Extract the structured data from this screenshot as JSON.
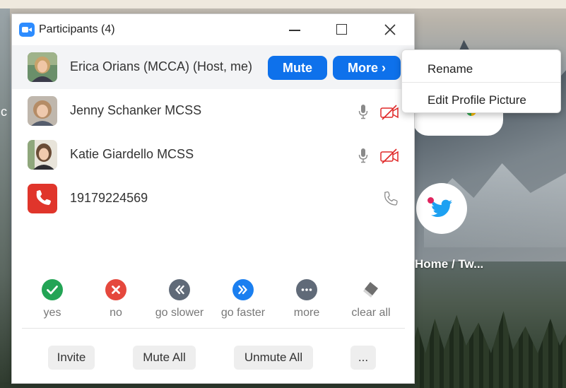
{
  "window": {
    "title": "Participants (4)"
  },
  "participants": [
    {
      "name": "Erica Orians (MCCA) (Host, me)",
      "avatar": "photo",
      "mute_label": "Mute",
      "more_label": "More ›"
    },
    {
      "name": "Jenny Schanker MCSS",
      "avatar": "photo",
      "mic": "mic-icon",
      "video": "video-off-icon"
    },
    {
      "name": "Katie Giardello MCSS",
      "avatar": "photo",
      "mic": "mic-icon",
      "video": "video-off-icon"
    },
    {
      "name": "19179224569",
      "avatar": "phone-avatar",
      "audio": "phone-icon"
    }
  ],
  "feedback": [
    {
      "label": "yes",
      "color": "#23a455",
      "icon": "check-icon"
    },
    {
      "label": "no",
      "color": "#e5483d",
      "icon": "x-icon"
    },
    {
      "label": "go slower",
      "color": "#606a78",
      "icon": "double-chevron-left-icon"
    },
    {
      "label": "go faster",
      "color": "#1a7ff0",
      "icon": "double-chevron-right-icon"
    },
    {
      "label": "more",
      "color": "#606a78",
      "icon": "ellipsis-icon"
    },
    {
      "label": "clear all",
      "color": "#7f7f7f",
      "icon": "eraser-icon"
    }
  ],
  "footer": {
    "invite": "Invite",
    "mute_all": "Mute All",
    "unmute_all": "Unmute All",
    "more": "..."
  },
  "context_menu": {
    "items": [
      "Rename",
      "Edit Profile Picture"
    ]
  },
  "background": {
    "shortcut_label": "Home / Tw...",
    "left_text": "c"
  },
  "colors": {
    "accent": "#0e71eb",
    "host_row_bg": "#f3f4f6"
  }
}
